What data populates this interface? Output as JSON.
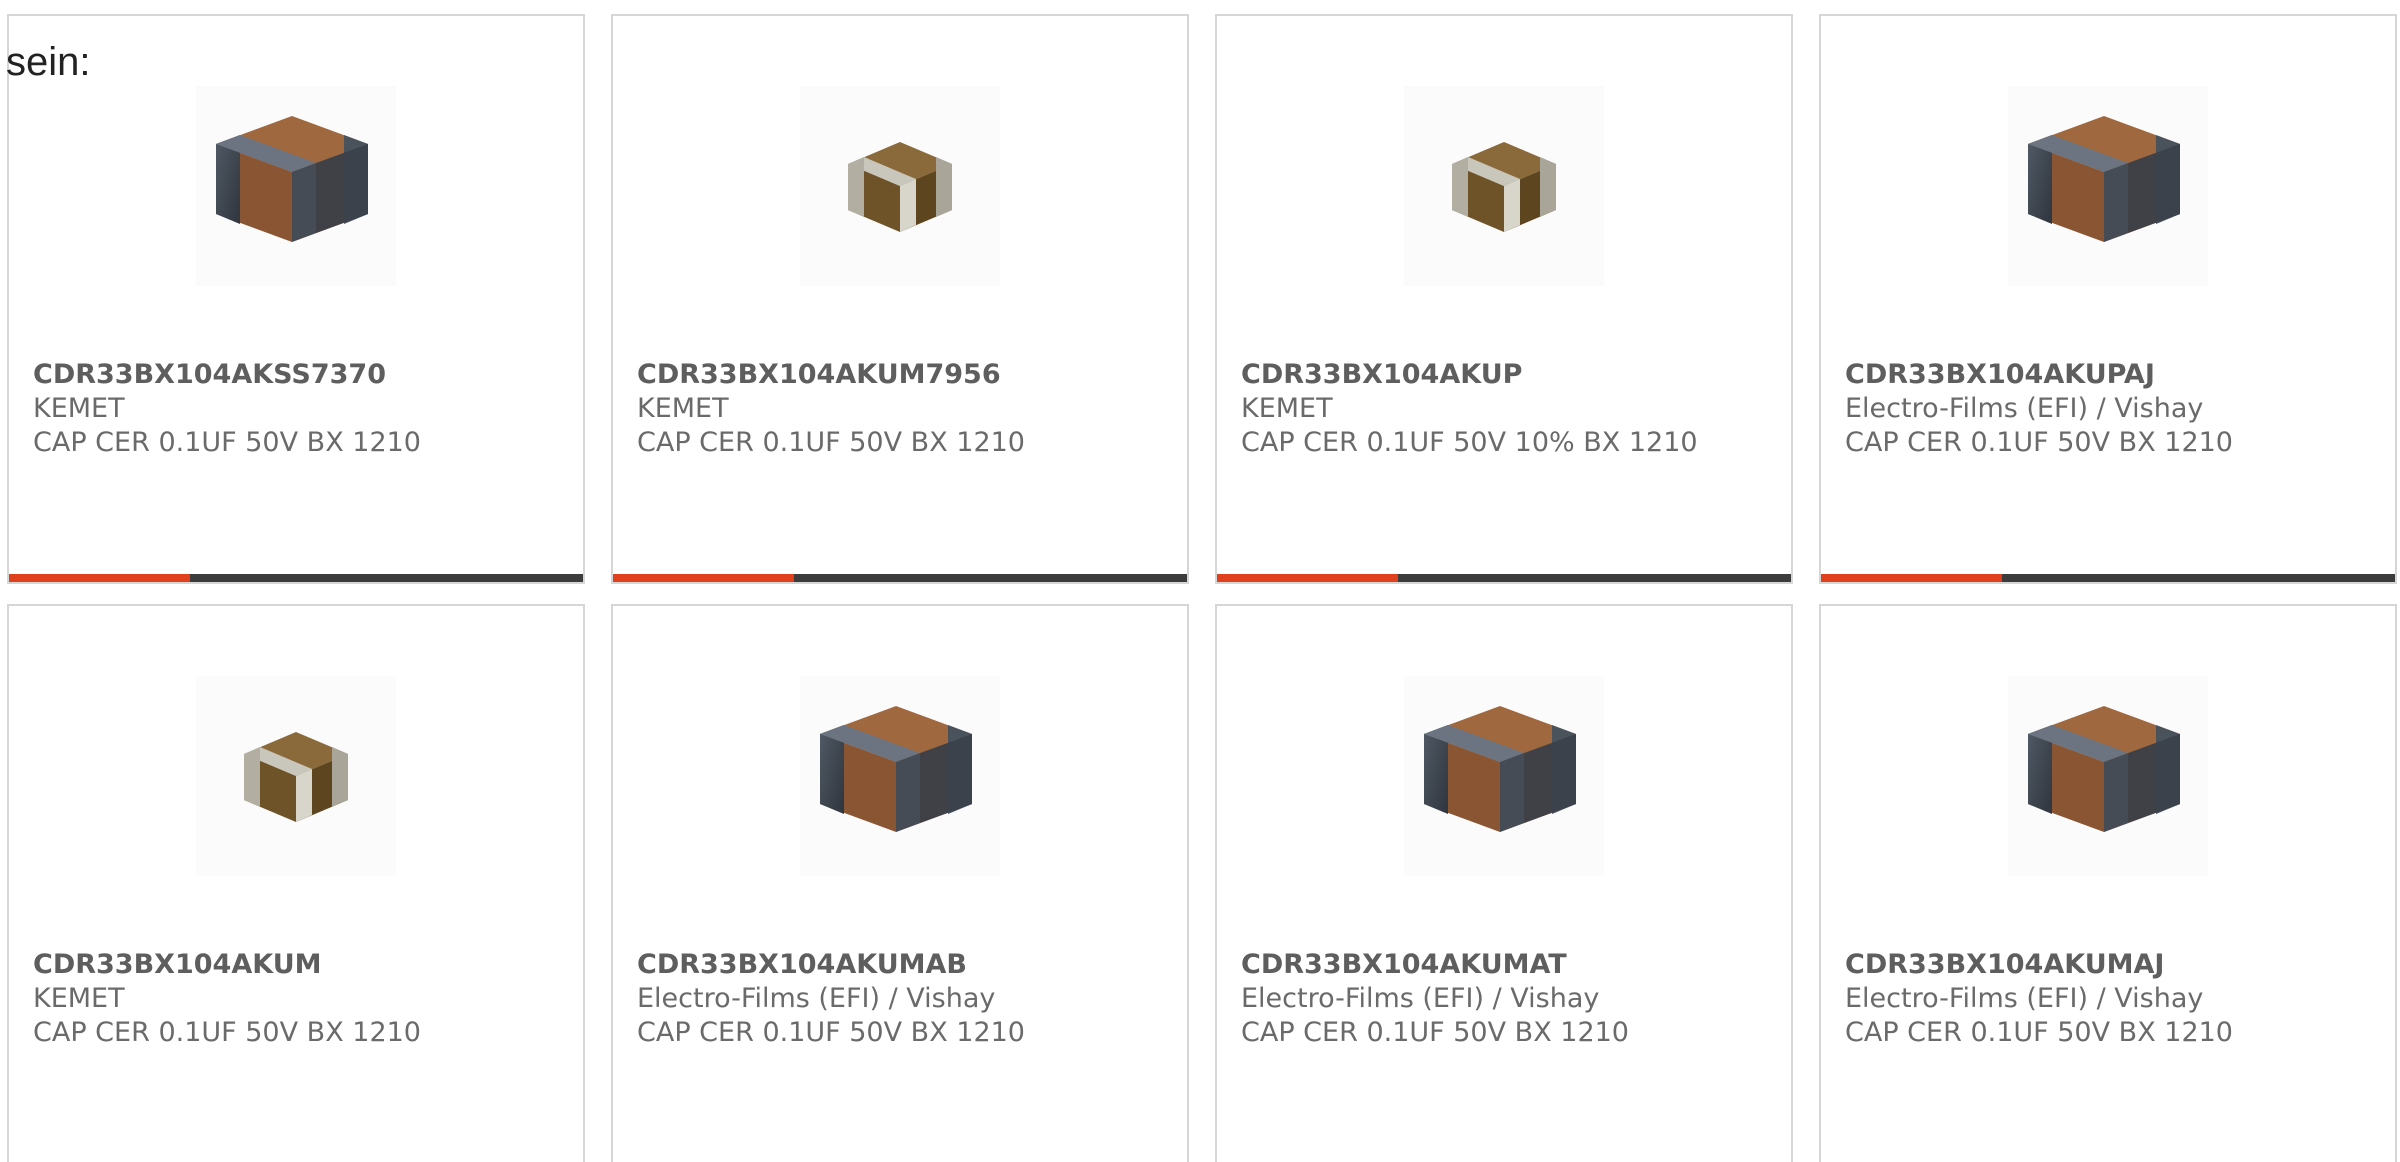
{
  "intro_text": "sein:",
  "colors": {
    "accent": "#e0401c",
    "bar_track": "#3c3c3c",
    "card_border": "#d6d6d6"
  },
  "bar_progress": 0.315,
  "products": [
    {
      "part_number": "CDR33BX104AKSS7370",
      "manufacturer": "KEMET",
      "description": "CAP CER 0.1UF 50V BX 1210",
      "image": "large-chip-capacitor-icon"
    },
    {
      "part_number": "CDR33BX104AKUM7956",
      "manufacturer": "KEMET",
      "description": "CAP CER 0.1UF 50V BX 1210",
      "image": "small-chip-capacitor-icon"
    },
    {
      "part_number": "CDR33BX104AKUP",
      "manufacturer": "KEMET",
      "description": "CAP CER 0.1UF 50V 10% BX 1210",
      "image": "small-chip-capacitor-icon"
    },
    {
      "part_number": "CDR33BX104AKUPAJ",
      "manufacturer": "Electro-Films (EFI) / Vishay",
      "description": "CAP CER 0.1UF 50V BX 1210",
      "image": "large-chip-capacitor-icon"
    },
    {
      "part_number": "CDR33BX104AKUM",
      "manufacturer": "KEMET",
      "description": "CAP CER 0.1UF 50V BX 1210",
      "image": "small-chip-capacitor-icon"
    },
    {
      "part_number": "CDR33BX104AKUMAB",
      "manufacturer": "Electro-Films (EFI) / Vishay",
      "description": "CAP CER 0.1UF 50V BX 1210",
      "image": "large-chip-capacitor-icon"
    },
    {
      "part_number": "CDR33BX104AKUMAT",
      "manufacturer": "Electro-Films (EFI) / Vishay",
      "description": "CAP CER 0.1UF 50V BX 1210",
      "image": "large-chip-capacitor-icon"
    },
    {
      "part_number": "CDR33BX104AKUMAJ",
      "manufacturer": "Electro-Films (EFI) / Vishay",
      "description": "CAP CER 0.1UF 50V BX 1210",
      "image": "large-chip-capacitor-icon"
    }
  ]
}
